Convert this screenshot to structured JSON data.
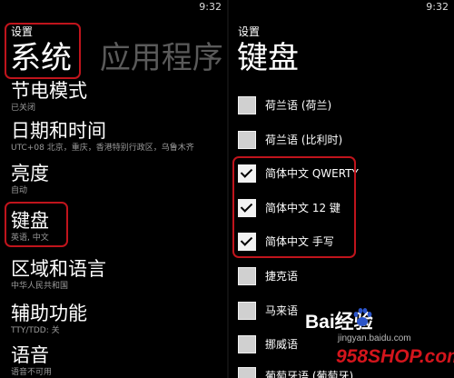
{
  "status_bar": {
    "left_time": "9:32",
    "right_time": "9:32"
  },
  "left_panel": {
    "breadcrumb": "设置",
    "title": "系统",
    "next_pivot": "应用程序",
    "items": [
      {
        "title": "节电模式",
        "subtitle": "已关闭"
      },
      {
        "title": "日期和时间",
        "subtitle": "UTC+08 北京，重庆，香港特别行政区，乌鲁木齐"
      },
      {
        "title": "亮度",
        "subtitle": "自动"
      },
      {
        "title": "键盘",
        "subtitle": "英语, 中文"
      },
      {
        "title": "区域和语言",
        "subtitle": "中华人民共和国"
      },
      {
        "title": "辅助功能",
        "subtitle": "TTY/TDD: 关"
      },
      {
        "title": "语音",
        "subtitle": "语音不可用"
      }
    ]
  },
  "right_panel": {
    "breadcrumb": "设置",
    "title": "键盘",
    "keyboards": [
      {
        "label": "荷兰语 (荷兰)",
        "checked": false
      },
      {
        "label": "荷兰语 (比利时)",
        "checked": false
      },
      {
        "label": "简体中文 QWERTY",
        "checked": true
      },
      {
        "label": "简体中文 12 键",
        "checked": true
      },
      {
        "label": "简体中文 手写",
        "checked": true
      },
      {
        "label": "捷克语",
        "checked": false
      },
      {
        "label": "马来语",
        "checked": false
      },
      {
        "label": "挪威语",
        "checked": false
      },
      {
        "label": "葡萄牙语 (葡萄牙)",
        "checked": false
      }
    ]
  },
  "watermark": {
    "brand_line": "Bai经验",
    "url_line": "jingyan.baidu.com",
    "site": "958SHOP.com"
  },
  "colors": {
    "highlight": "#c0141c",
    "background": "#000000",
    "brand_red": "#d4151c",
    "brand_blue": "#2b54c8"
  }
}
